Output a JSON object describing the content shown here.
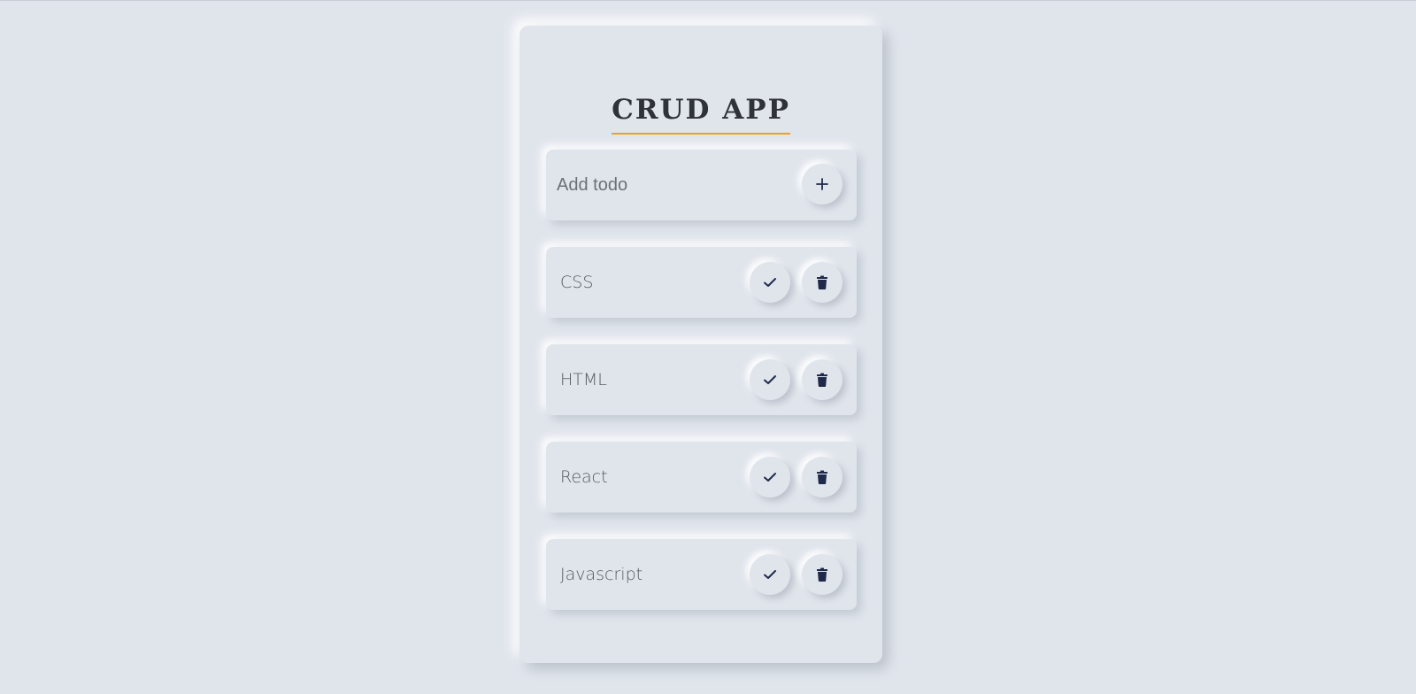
{
  "app": {
    "title": "CRUD APP"
  },
  "add_form": {
    "placeholder": "Add todo",
    "value": "",
    "button_icon": "plus-icon"
  },
  "todos": [
    {
      "text": "CSS",
      "check_icon": "check-icon",
      "delete_icon": "trash-icon"
    },
    {
      "text": "HTML",
      "check_icon": "check-icon",
      "delete_icon": "trash-icon"
    },
    {
      "text": "React",
      "check_icon": "check-icon",
      "delete_icon": "trash-icon"
    },
    {
      "text": "Javascript",
      "check_icon": "check-icon",
      "delete_icon": "trash-icon"
    }
  ],
  "colors": {
    "background": "#e0e5ec",
    "title_underline": "#f0a020",
    "icon": "#1f2a4a",
    "title_text": "#2f3238"
  }
}
